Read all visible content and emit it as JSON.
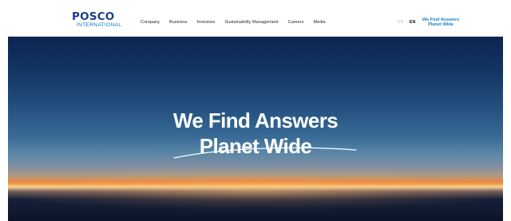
{
  "header": {
    "logo": {
      "main": "POSCO",
      "sub": "INTERNATIONAL"
    },
    "nav": [
      {
        "label": "Company"
      },
      {
        "label": "Business"
      },
      {
        "label": "Investors"
      },
      {
        "label": "Sustainability Management"
      },
      {
        "label": "Careers"
      },
      {
        "label": "Media"
      }
    ],
    "lang": {
      "kr": "KR",
      "separator": "|",
      "en": "EN"
    },
    "tagline": {
      "line1": "We Find Answers",
      "line2": "Planet Wide"
    }
  },
  "hero": {
    "title_line1": "We Find Answers",
    "title_line2": "Planet Wide"
  },
  "colors": {
    "brand_navy": "#1b3f8a",
    "brand_blue": "#0c7bc1",
    "tagline_blue": "#1f87c9"
  }
}
